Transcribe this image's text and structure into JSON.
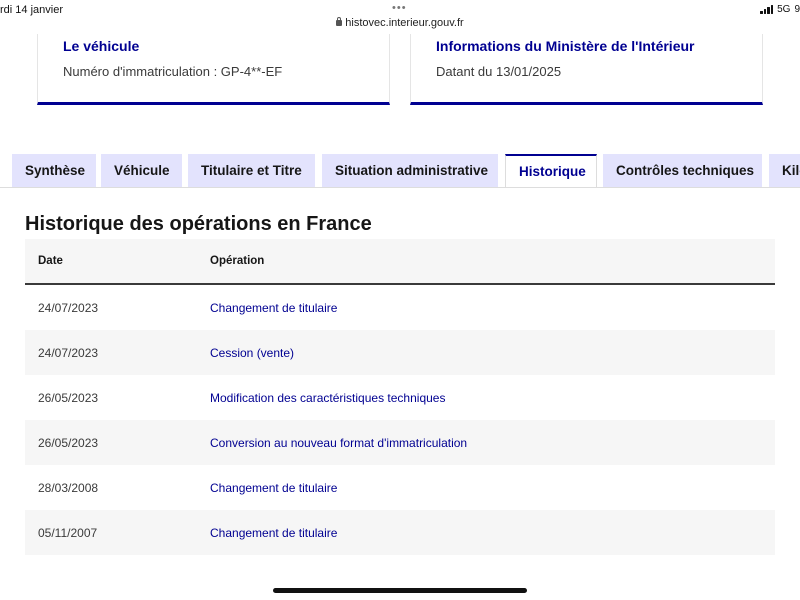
{
  "status": {
    "date": "rdi 14 janvier",
    "network": "5G",
    "battery": "9",
    "url": "histovec.interieur.gouv.fr"
  },
  "cards": [
    {
      "title": "Le véhicule",
      "text": "Numéro d'immatriculation : GP-4**-EF"
    },
    {
      "title": "Informations du Ministère de l'Intérieur",
      "text": "Datant du 13/01/2025"
    }
  ],
  "tabs": [
    {
      "label": "Synthèse"
    },
    {
      "label": "Véhicule"
    },
    {
      "label": "Titulaire et Titre"
    },
    {
      "label": "Situation administrative"
    },
    {
      "label": "Historique"
    },
    {
      "label": "Contrôles techniques"
    },
    {
      "label": "Kilométrage"
    }
  ],
  "colors": {
    "accent": "#000091",
    "tab_bg": "#e3e3fd",
    "stripe": "#f6f6f6"
  },
  "history": {
    "title": "Historique des opérations en France",
    "columns": {
      "date": "Date",
      "operation": "Opération"
    },
    "rows": [
      {
        "date": "24/07/2023",
        "operation": "Changement de titulaire"
      },
      {
        "date": "24/07/2023",
        "operation": "Cession (vente)"
      },
      {
        "date": "26/05/2023",
        "operation": "Modification des caractéristiques techniques"
      },
      {
        "date": "26/05/2023",
        "operation": "Conversion au nouveau format d'immatriculation"
      },
      {
        "date": "28/03/2008",
        "operation": "Changement de titulaire"
      },
      {
        "date": "05/11/2007",
        "operation": "Changement de titulaire"
      }
    ]
  }
}
